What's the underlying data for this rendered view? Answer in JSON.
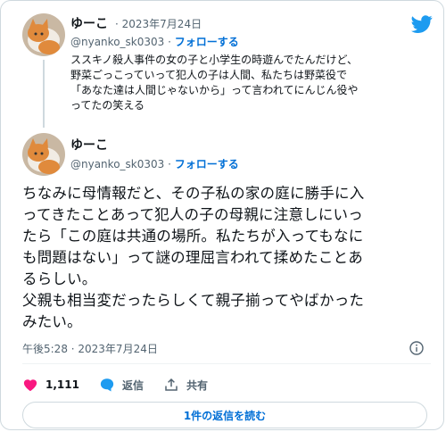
{
  "quoted": {
    "name": "ゆーこ",
    "date": "· 2023年7月24日",
    "handle": "@nyanko_sk0303 ·",
    "follow": "フォローする",
    "text": "ススキノ殺人事件の女の子と小学生の時遊んでたんだけど、\n野菜ごっこっていって犯人の子は人間、私たちは野菜役で\n「あなた達は人間じゃないから」って言われてにんじん役や\nってたの笑える"
  },
  "main": {
    "name": "ゆーこ",
    "handle": "@nyanko_sk0303 ·",
    "follow": "フォローする",
    "text": "ちなみに母情報だと、その子私の家の庭に勝手に入\nってきたことあって犯人の子の母親に注意しにいっ\nたら「この庭は共通の場所。私たちが入ってもなに\nも問題はない」って謎の理屈言われて揉めたことあ\nるらしい。\n父親も相当変だったらしくて親子揃ってやばかった\nみたい。",
    "timestamp": "午後5:28 · 2023年7月24日"
  },
  "actions": {
    "likes": "1,111",
    "reply": "返信",
    "share": "共有"
  },
  "read_replies": "1件の返信を読む",
  "colors": {
    "like": "#f91880",
    "reply": "#1d9bf0",
    "link": "#006fd6",
    "twitter": "#1d9bf0"
  }
}
